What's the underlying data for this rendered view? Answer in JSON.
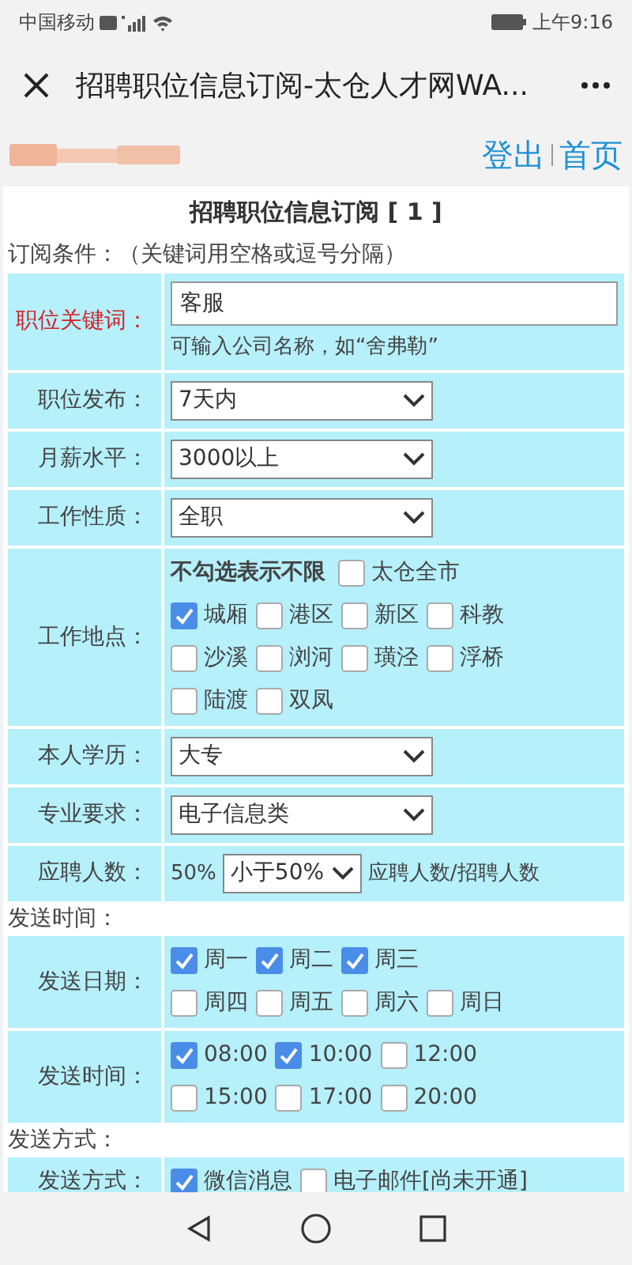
{
  "status_bar": {
    "carrier": "中国移动",
    "time": "上午9:16"
  },
  "title_bar": {
    "title": "招聘职位信息订阅-太仓人才网WA..."
  },
  "header": {
    "links": [
      "登出",
      "首页"
    ]
  },
  "form": {
    "title": "招聘职位信息订阅 [ 1 ]",
    "sections": [
      {
        "heading": "订阅条件：（关键词用空格或逗号分隔）",
        "rows": [
          {
            "kind": "text",
            "label": "职位关键词：",
            "highlighted": true,
            "value": "客服",
            "hint": "可输入公司名称，如“舍弗勒”"
          },
          {
            "kind": "select",
            "label": "职位发布：",
            "highlighted": false,
            "value": "7天内"
          },
          {
            "kind": "select",
            "label": "月薪水平：",
            "highlighted": false,
            "value": "3000以上"
          },
          {
            "kind": "select",
            "label": "工作性质：",
            "highlighted": false,
            "value": "全职"
          },
          {
            "kind": "checks",
            "label": "工作地点：",
            "highlighted": false,
            "note": "不勾选表示不限",
            "lines": [
              [
                {
                  "label": "太仓全市",
                  "checked": false
                }
              ],
              [
                {
                  "label": "城厢",
                  "checked": true
                },
                {
                  "label": "港区",
                  "checked": false
                },
                {
                  "label": "新区",
                  "checked": false
                },
                {
                  "label": "科教",
                  "checked": false
                }
              ],
              [
                {
                  "label": "沙溪",
                  "checked": false
                },
                {
                  "label": "浏河",
                  "checked": false
                },
                {
                  "label": "璜泾",
                  "checked": false
                },
                {
                  "label": "浮桥",
                  "checked": false
                }
              ],
              [
                {
                  "label": "陆渡",
                  "checked": false
                },
                {
                  "label": "双凤",
                  "checked": false
                }
              ]
            ]
          },
          {
            "kind": "select",
            "label": "本人学历：",
            "highlighted": false,
            "value": "大专"
          },
          {
            "kind": "select",
            "label": "专业要求：",
            "highlighted": false,
            "value": "电子信息类"
          },
          {
            "kind": "ratio",
            "label": "应聘人数：",
            "highlighted": false,
            "prefix": "50%",
            "value": "小于50%",
            "suffix": "应聘人数/招聘人数"
          }
        ]
      },
      {
        "heading": "发送时间：",
        "rows": [
          {
            "kind": "checks",
            "label": "发送日期：",
            "highlighted": false,
            "lines": [
              [
                {
                  "label": "周一",
                  "checked": true
                },
                {
                  "label": "周二",
                  "checked": true
                },
                {
                  "label": "周三",
                  "checked": true
                }
              ],
              [
                {
                  "label": "周四",
                  "checked": false
                },
                {
                  "label": "周五",
                  "checked": false
                },
                {
                  "label": "周六",
                  "checked": false
                },
                {
                  "label": "周日",
                  "checked": false
                }
              ]
            ]
          },
          {
            "kind": "checks",
            "label": "发送时间：",
            "highlighted": false,
            "lines": [
              [
                {
                  "label": "08:00",
                  "checked": true
                },
                {
                  "label": "10:00",
                  "checked": true
                },
                {
                  "label": "12:00",
                  "checked": false
                }
              ],
              [
                {
                  "label": "15:00",
                  "checked": false
                },
                {
                  "label": "17:00",
                  "checked": false
                },
                {
                  "label": "20:00",
                  "checked": false
                }
              ]
            ]
          }
        ]
      },
      {
        "heading": "发送方式：",
        "rows": [
          {
            "kind": "checks",
            "label": "发送方式：",
            "highlighted": false,
            "lines": [
              [
                {
                  "label": "微信消息",
                  "checked": true
                },
                {
                  "label": "电子邮件[尚未开通]",
                  "checked": false
                }
              ]
            ]
          }
        ]
      }
    ]
  }
}
